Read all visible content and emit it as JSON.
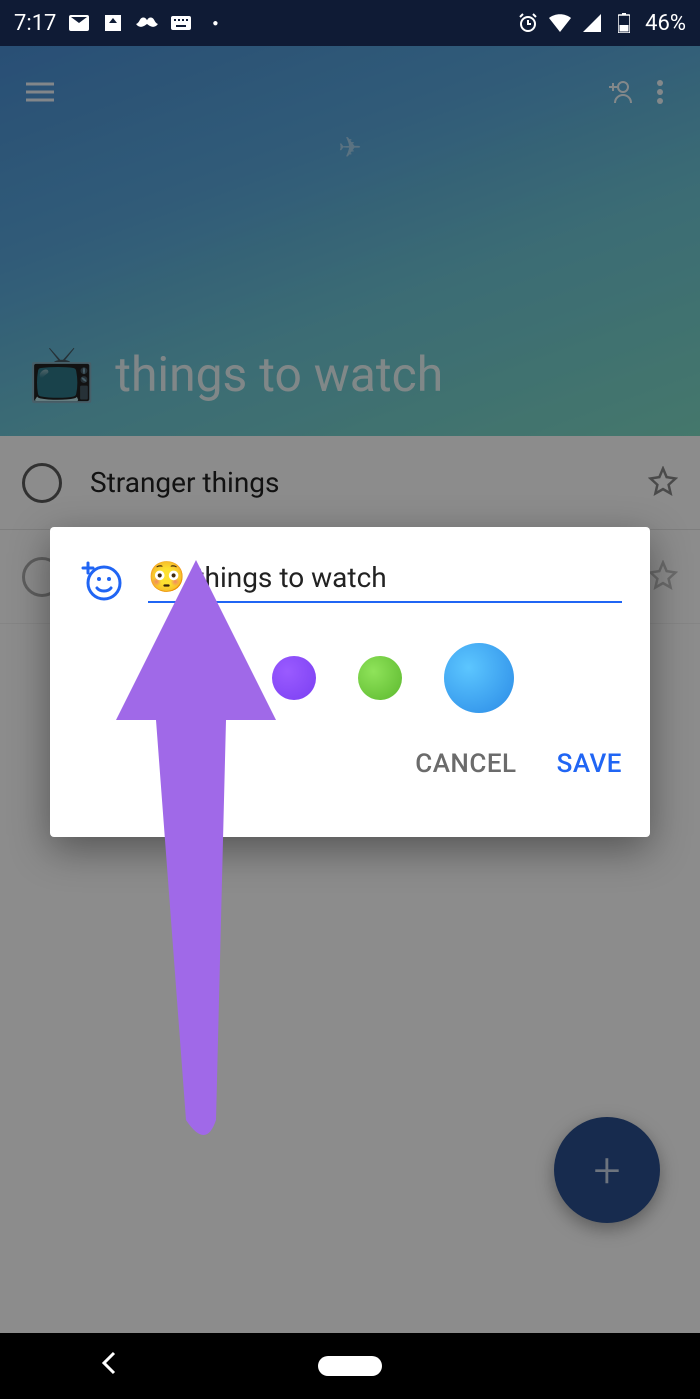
{
  "statusbar": {
    "time": "7:17",
    "battery": "46%"
  },
  "header": {
    "title_emoji": "📺",
    "title": "things to watch"
  },
  "items": [
    {
      "text": "Stranger things"
    }
  ],
  "dialog": {
    "input_emoji": "😳",
    "input_value": "things to watch",
    "colors": [
      {
        "hex": "#f26a54",
        "selected": false
      },
      {
        "hex": "#7b3ff2",
        "selected": false
      },
      {
        "hex": "#6ec93e",
        "selected": false
      },
      {
        "hex": "#3aa6f2",
        "selected": true
      }
    ],
    "cancel": "CANCEL",
    "save": "SAVE"
  },
  "fab": {
    "label": "+"
  }
}
